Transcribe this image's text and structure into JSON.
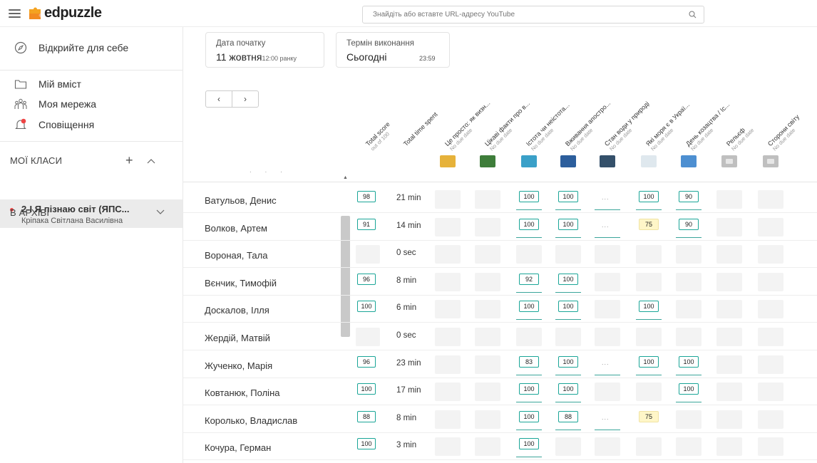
{
  "app": {
    "logo": "edpuzzle"
  },
  "search": {
    "placeholder": "Знайдіть або вставте URL-адресу YouTube"
  },
  "sidebar": {
    "discover": "Відкрийте для себе",
    "my_content": "Мій вміст",
    "my_network": "Моя мережа",
    "notifications": "Сповіщення",
    "my_classes": "МОЇ КЛАСИ",
    "class_name": "2-І Я пізнаю світ (ЯПС...",
    "class_teacher": "Кріпака Світлана Василівна",
    "archive": "В АРХІВІ"
  },
  "dates": {
    "start_label": "Дата початку",
    "start_value": "11 жовтня",
    "start_time": "12:00 ранку",
    "due_label": "Термін виконання",
    "due_value": "Сьогодні",
    "due_time": "23:59"
  },
  "columns": [
    {
      "title": "Total score",
      "sub": "out of 100"
    },
    {
      "title": "Total time spent",
      "sub": ""
    },
    {
      "title": "Це просто: як визн...",
      "sub": "No due date"
    },
    {
      "title": "Цікаві факти про в...",
      "sub": "No due date"
    },
    {
      "title": "Істота чи неістота...",
      "sub": "No due date"
    },
    {
      "title": "Вживання апостро...",
      "sub": "No due date"
    },
    {
      "title": "Стан води у природі",
      "sub": "No due date"
    },
    {
      "title": "Які моря є в Украї...",
      "sub": "No due date"
    },
    {
      "title": "День козацтва / Іс...",
      "sub": "No due date"
    },
    {
      "title": "Рельєф",
      "sub": "No due date"
    },
    {
      "title": "Сторони світу",
      "sub": "No due date"
    }
  ],
  "thumbnail_colors": [
    "#e6b23a",
    "#3e7d3a",
    "#3aa0c8",
    "#2c5e9c",
    "#34506a",
    "#dfe8ee",
    "#4d8fd1",
    "#bfbfbf",
    "#bfbfbf"
  ],
  "students": [
    {
      "name": "Ватульов, Денис",
      "total": "98",
      "time": "21 min",
      "scores": [
        "",
        "",
        "100",
        "100",
        "...",
        "100",
        "90",
        "",
        ""
      ]
    },
    {
      "name": "Волков, Артем",
      "total": "91",
      "time": "14 min",
      "scores": [
        "",
        "",
        "100",
        "100",
        "...",
        "75",
        "90",
        "",
        ""
      ]
    },
    {
      "name": "Вороная, Тала",
      "total": "",
      "time": "0 sec",
      "scores": [
        "",
        "",
        "",
        "",
        "",
        "",
        "",
        "",
        ""
      ]
    },
    {
      "name": "Вєнчик, Тимофій",
      "total": "96",
      "time": "8 min",
      "scores": [
        "",
        "",
        "92",
        "100",
        "",
        "",
        "",
        "",
        ""
      ]
    },
    {
      "name": "Доскалов, Ілля",
      "total": "100",
      "time": "6 min",
      "scores": [
        "",
        "",
        "100",
        "100",
        "",
        "100",
        "",
        "",
        ""
      ]
    },
    {
      "name": "Жердій, Матвій",
      "total": "",
      "time": "0 sec",
      "scores": [
        "",
        "",
        "",
        "",
        "",
        "",
        "",
        "",
        ""
      ]
    },
    {
      "name": "Жученко, Марія",
      "total": "96",
      "time": "23 min",
      "scores": [
        "",
        "",
        "83",
        "100",
        "...",
        "100",
        "100",
        "",
        ""
      ]
    },
    {
      "name": "Ковтанюк, Поліна",
      "total": "100",
      "time": "17 min",
      "scores": [
        "",
        "",
        "100",
        "100",
        "",
        "",
        "100",
        "",
        ""
      ]
    },
    {
      "name": "Королько, Владислав",
      "total": "88",
      "time": "8 min",
      "scores": [
        "",
        "",
        "100",
        "88",
        "...",
        "75",
        "",
        "",
        ""
      ]
    },
    {
      "name": "Кочура, Герман",
      "total": "100",
      "time": "3 min",
      "scores": [
        "",
        "",
        "100",
        "",
        "",
        "",
        "",
        "",
        ""
      ]
    }
  ],
  "colors": {
    "score_border": "#1aa597",
    "yellow_score_bg": "#fff6c8",
    "accent_red": "#e44"
  }
}
